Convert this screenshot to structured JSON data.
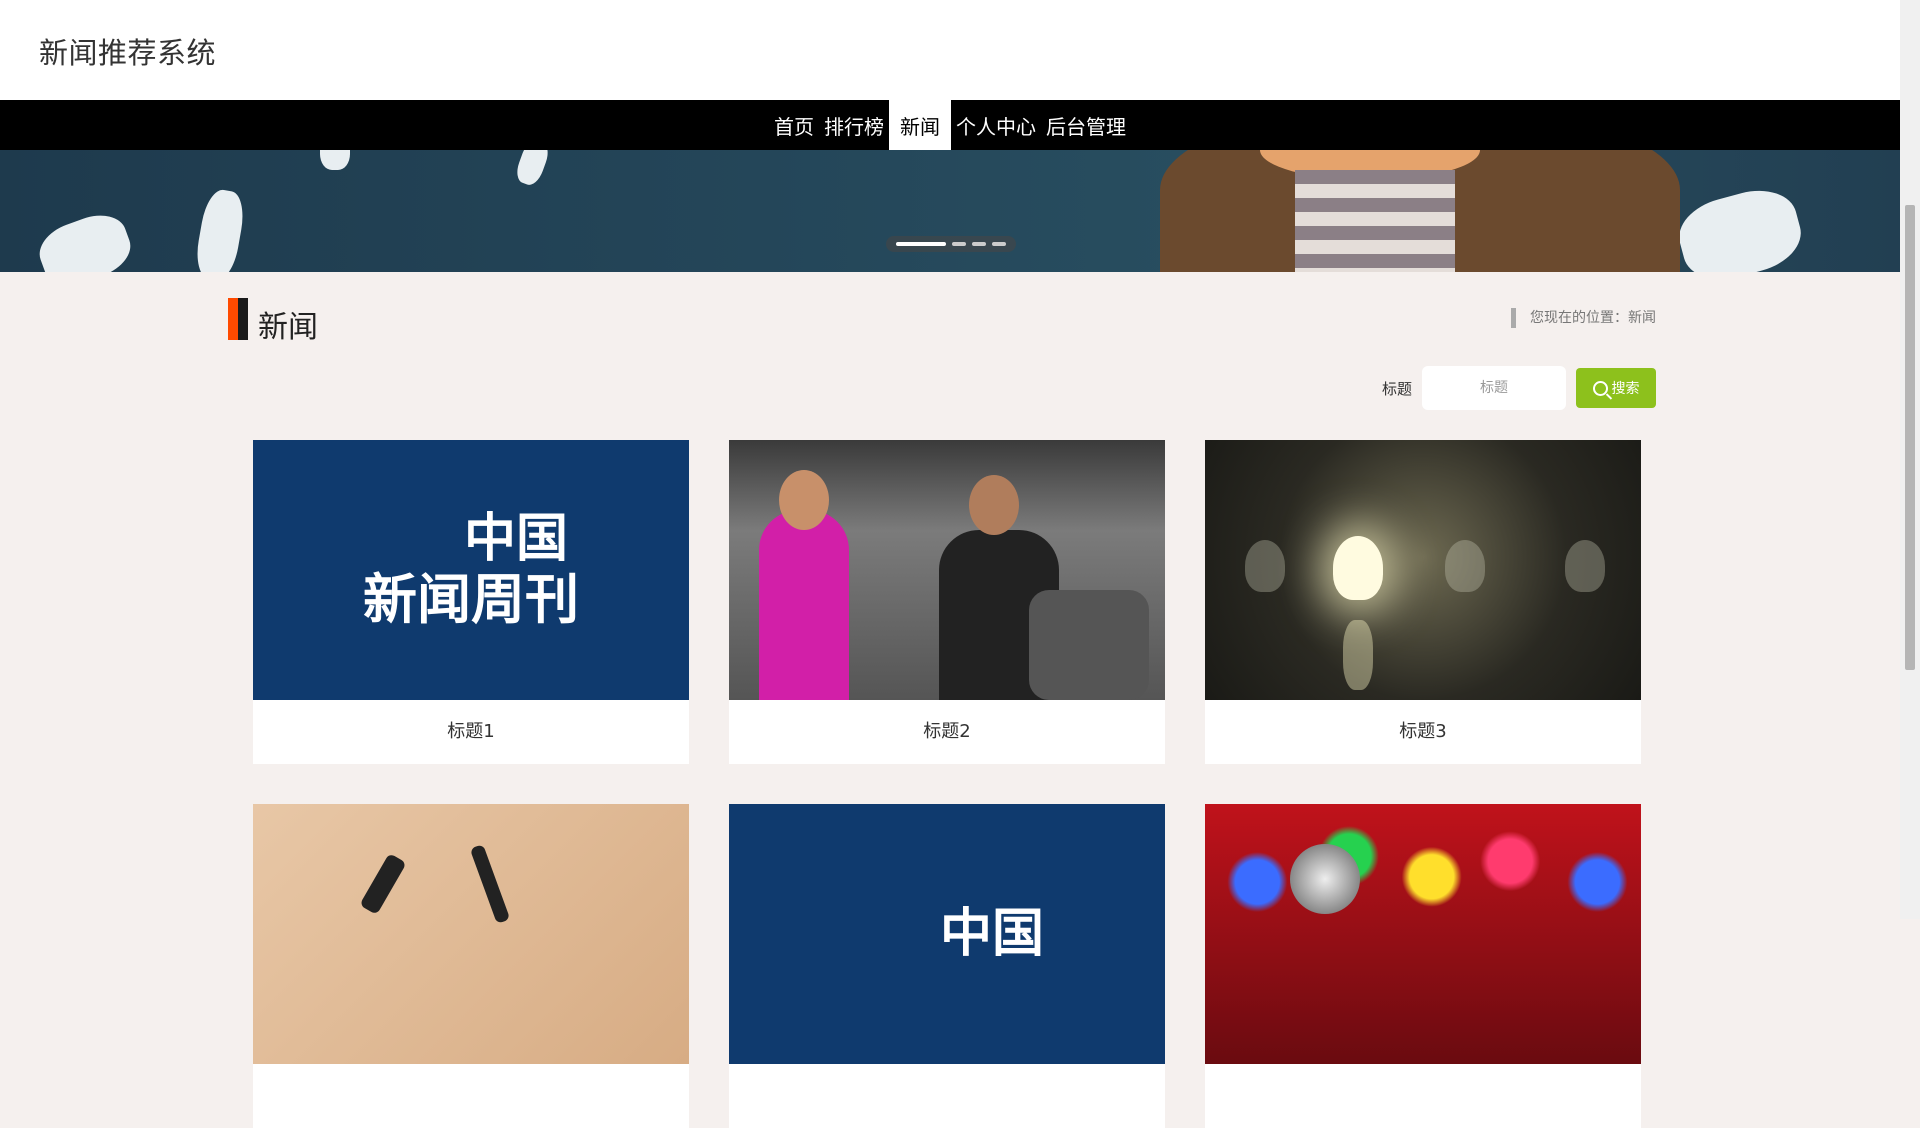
{
  "site": {
    "title": "新闻推荐系统"
  },
  "nav": {
    "items": [
      {
        "label": "首页",
        "active": false
      },
      {
        "label": "排行榜",
        "active": false
      },
      {
        "label": "新闻",
        "active": true
      },
      {
        "label": "个人中心",
        "active": false
      },
      {
        "label": "后台管理",
        "active": false
      }
    ]
  },
  "banner": {
    "slide_count": 4,
    "active_slide": 1
  },
  "section": {
    "title": "新闻",
    "breadcrumb": "您现在的位置：新闻"
  },
  "search": {
    "label": "标题",
    "placeholder": "标题",
    "button_label": "搜索"
  },
  "news": [
    {
      "title": "标题1",
      "image": "china-newsweek-logo",
      "logo_line1": "中国",
      "logo_line2": "新闻周刊"
    },
    {
      "title": "标题2",
      "image": "gym-exercise-photo"
    },
    {
      "title": "标题3",
      "image": "light-bulbs-photo"
    },
    {
      "title": "",
      "image": "calligraphy-paper-photo"
    },
    {
      "title": "",
      "image": "china-newsweek-logo",
      "logo_line1": "中国",
      "logo_line2": ""
    },
    {
      "title": "",
      "image": "microphone-lights-photo"
    }
  ],
  "colors": {
    "accent_green": "#8dc11c",
    "nav_bg": "#000000",
    "section_mark_orange": "#ff4a00",
    "logo_blue": "#0f3a6e"
  }
}
